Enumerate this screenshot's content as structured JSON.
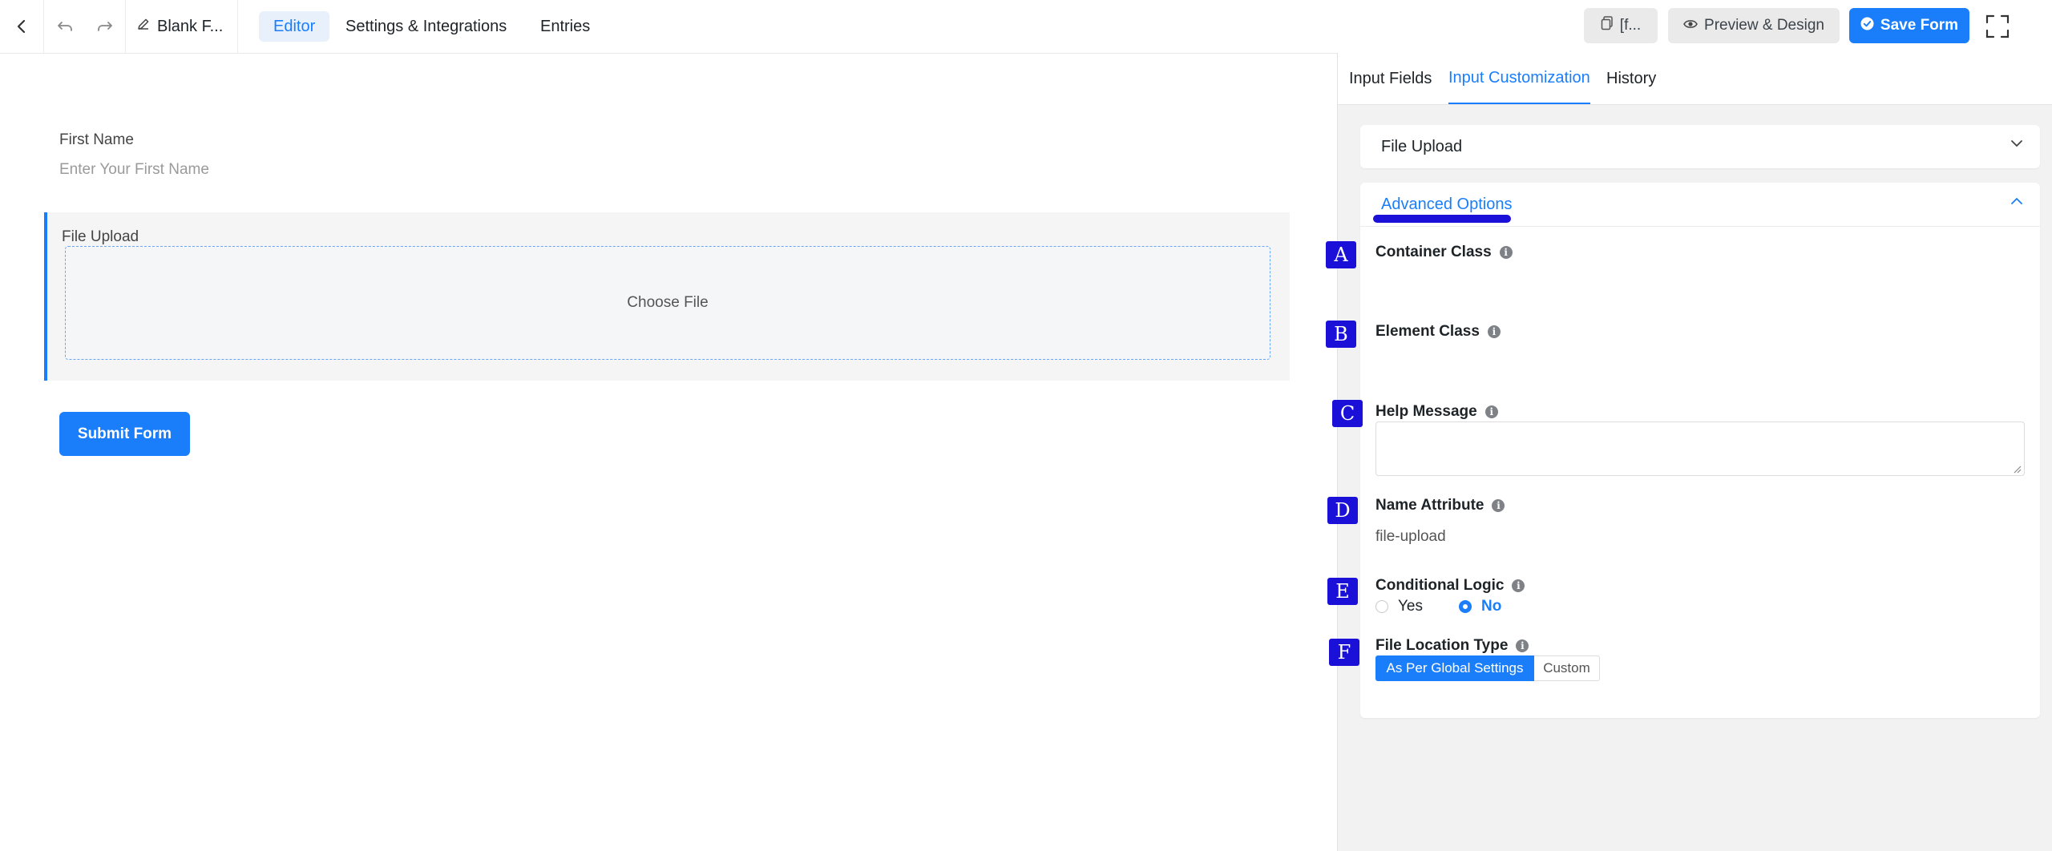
{
  "topbar": {
    "form_title": "Blank F...",
    "tabs": [
      {
        "label": "Editor",
        "active": true
      },
      {
        "label": "Settings & Integrations",
        "active": false
      },
      {
        "label": "Entries",
        "active": false
      }
    ],
    "shortcode_label": "[f...",
    "preview_label": "Preview & Design",
    "save_label": "Save Form"
  },
  "canvas": {
    "first_name_label": "First Name",
    "first_name_placeholder": "Enter Your First Name",
    "file_upload_label": "File Upload",
    "choose_file_label": "Choose File",
    "submit_label": "Submit Form"
  },
  "panel": {
    "tabs": [
      {
        "label": "Input Fields",
        "active": false
      },
      {
        "label": "Input Customization",
        "active": true
      },
      {
        "label": "History",
        "active": false
      }
    ],
    "section_title": "File Upload",
    "advanced_title": "Advanced Options",
    "fields": {
      "container_class": {
        "label": "Container Class",
        "marker": "A"
      },
      "element_class": {
        "label": "Element Class",
        "marker": "B"
      },
      "help_message": {
        "label": "Help Message",
        "marker": "C"
      },
      "name_attribute": {
        "label": "Name Attribute",
        "marker": "D",
        "value": "file-upload"
      },
      "conditional_logic": {
        "label": "Conditional Logic",
        "marker": "E",
        "options": [
          "Yes",
          "No"
        ],
        "selected": "No"
      },
      "file_location_type": {
        "label": "File Location Type",
        "marker": "F",
        "options": [
          "As Per Global Settings",
          "Custom"
        ],
        "selected": "As Per Global Settings"
      }
    }
  },
  "colors": {
    "accent": "#1a7efb",
    "marker_bg": "#1a10d8",
    "panel_bg": "#f2f2f2"
  }
}
